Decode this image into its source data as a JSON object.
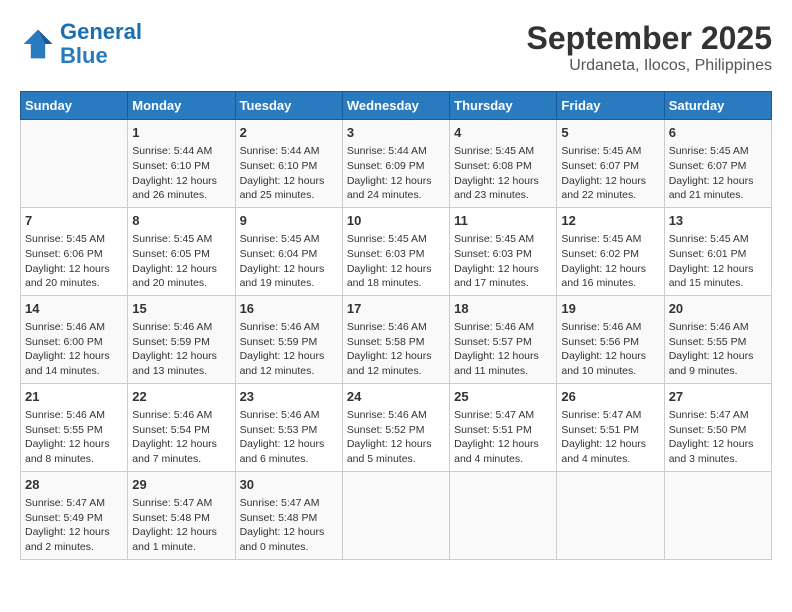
{
  "header": {
    "logo_line1": "General",
    "logo_line2": "Blue",
    "title": "September 2025",
    "subtitle": "Urdaneta, Ilocos, Philippines"
  },
  "days_of_week": [
    "Sunday",
    "Monday",
    "Tuesday",
    "Wednesday",
    "Thursday",
    "Friday",
    "Saturday"
  ],
  "weeks": [
    [
      {
        "day": "",
        "content": ""
      },
      {
        "day": "1",
        "content": "Sunrise: 5:44 AM\nSunset: 6:10 PM\nDaylight: 12 hours\nand 26 minutes."
      },
      {
        "day": "2",
        "content": "Sunrise: 5:44 AM\nSunset: 6:10 PM\nDaylight: 12 hours\nand 25 minutes."
      },
      {
        "day": "3",
        "content": "Sunrise: 5:44 AM\nSunset: 6:09 PM\nDaylight: 12 hours\nand 24 minutes."
      },
      {
        "day": "4",
        "content": "Sunrise: 5:45 AM\nSunset: 6:08 PM\nDaylight: 12 hours\nand 23 minutes."
      },
      {
        "day": "5",
        "content": "Sunrise: 5:45 AM\nSunset: 6:07 PM\nDaylight: 12 hours\nand 22 minutes."
      },
      {
        "day": "6",
        "content": "Sunrise: 5:45 AM\nSunset: 6:07 PM\nDaylight: 12 hours\nand 21 minutes."
      }
    ],
    [
      {
        "day": "7",
        "content": "Sunrise: 5:45 AM\nSunset: 6:06 PM\nDaylight: 12 hours\nand 20 minutes."
      },
      {
        "day": "8",
        "content": "Sunrise: 5:45 AM\nSunset: 6:05 PM\nDaylight: 12 hours\nand 20 minutes."
      },
      {
        "day": "9",
        "content": "Sunrise: 5:45 AM\nSunset: 6:04 PM\nDaylight: 12 hours\nand 19 minutes."
      },
      {
        "day": "10",
        "content": "Sunrise: 5:45 AM\nSunset: 6:03 PM\nDaylight: 12 hours\nand 18 minutes."
      },
      {
        "day": "11",
        "content": "Sunrise: 5:45 AM\nSunset: 6:03 PM\nDaylight: 12 hours\nand 17 minutes."
      },
      {
        "day": "12",
        "content": "Sunrise: 5:45 AM\nSunset: 6:02 PM\nDaylight: 12 hours\nand 16 minutes."
      },
      {
        "day": "13",
        "content": "Sunrise: 5:45 AM\nSunset: 6:01 PM\nDaylight: 12 hours\nand 15 minutes."
      }
    ],
    [
      {
        "day": "14",
        "content": "Sunrise: 5:46 AM\nSunset: 6:00 PM\nDaylight: 12 hours\nand 14 minutes."
      },
      {
        "day": "15",
        "content": "Sunrise: 5:46 AM\nSunset: 5:59 PM\nDaylight: 12 hours\nand 13 minutes."
      },
      {
        "day": "16",
        "content": "Sunrise: 5:46 AM\nSunset: 5:59 PM\nDaylight: 12 hours\nand 12 minutes."
      },
      {
        "day": "17",
        "content": "Sunrise: 5:46 AM\nSunset: 5:58 PM\nDaylight: 12 hours\nand 12 minutes."
      },
      {
        "day": "18",
        "content": "Sunrise: 5:46 AM\nSunset: 5:57 PM\nDaylight: 12 hours\nand 11 minutes."
      },
      {
        "day": "19",
        "content": "Sunrise: 5:46 AM\nSunset: 5:56 PM\nDaylight: 12 hours\nand 10 minutes."
      },
      {
        "day": "20",
        "content": "Sunrise: 5:46 AM\nSunset: 5:55 PM\nDaylight: 12 hours\nand 9 minutes."
      }
    ],
    [
      {
        "day": "21",
        "content": "Sunrise: 5:46 AM\nSunset: 5:55 PM\nDaylight: 12 hours\nand 8 minutes."
      },
      {
        "day": "22",
        "content": "Sunrise: 5:46 AM\nSunset: 5:54 PM\nDaylight: 12 hours\nand 7 minutes."
      },
      {
        "day": "23",
        "content": "Sunrise: 5:46 AM\nSunset: 5:53 PM\nDaylight: 12 hours\nand 6 minutes."
      },
      {
        "day": "24",
        "content": "Sunrise: 5:46 AM\nSunset: 5:52 PM\nDaylight: 12 hours\nand 5 minutes."
      },
      {
        "day": "25",
        "content": "Sunrise: 5:47 AM\nSunset: 5:51 PM\nDaylight: 12 hours\nand 4 minutes."
      },
      {
        "day": "26",
        "content": "Sunrise: 5:47 AM\nSunset: 5:51 PM\nDaylight: 12 hours\nand 4 minutes."
      },
      {
        "day": "27",
        "content": "Sunrise: 5:47 AM\nSunset: 5:50 PM\nDaylight: 12 hours\nand 3 minutes."
      }
    ],
    [
      {
        "day": "28",
        "content": "Sunrise: 5:47 AM\nSunset: 5:49 PM\nDaylight: 12 hours\nand 2 minutes."
      },
      {
        "day": "29",
        "content": "Sunrise: 5:47 AM\nSunset: 5:48 PM\nDaylight: 12 hours\nand 1 minute."
      },
      {
        "day": "30",
        "content": "Sunrise: 5:47 AM\nSunset: 5:48 PM\nDaylight: 12 hours\nand 0 minutes."
      },
      {
        "day": "",
        "content": ""
      },
      {
        "day": "",
        "content": ""
      },
      {
        "day": "",
        "content": ""
      },
      {
        "day": "",
        "content": ""
      }
    ]
  ]
}
